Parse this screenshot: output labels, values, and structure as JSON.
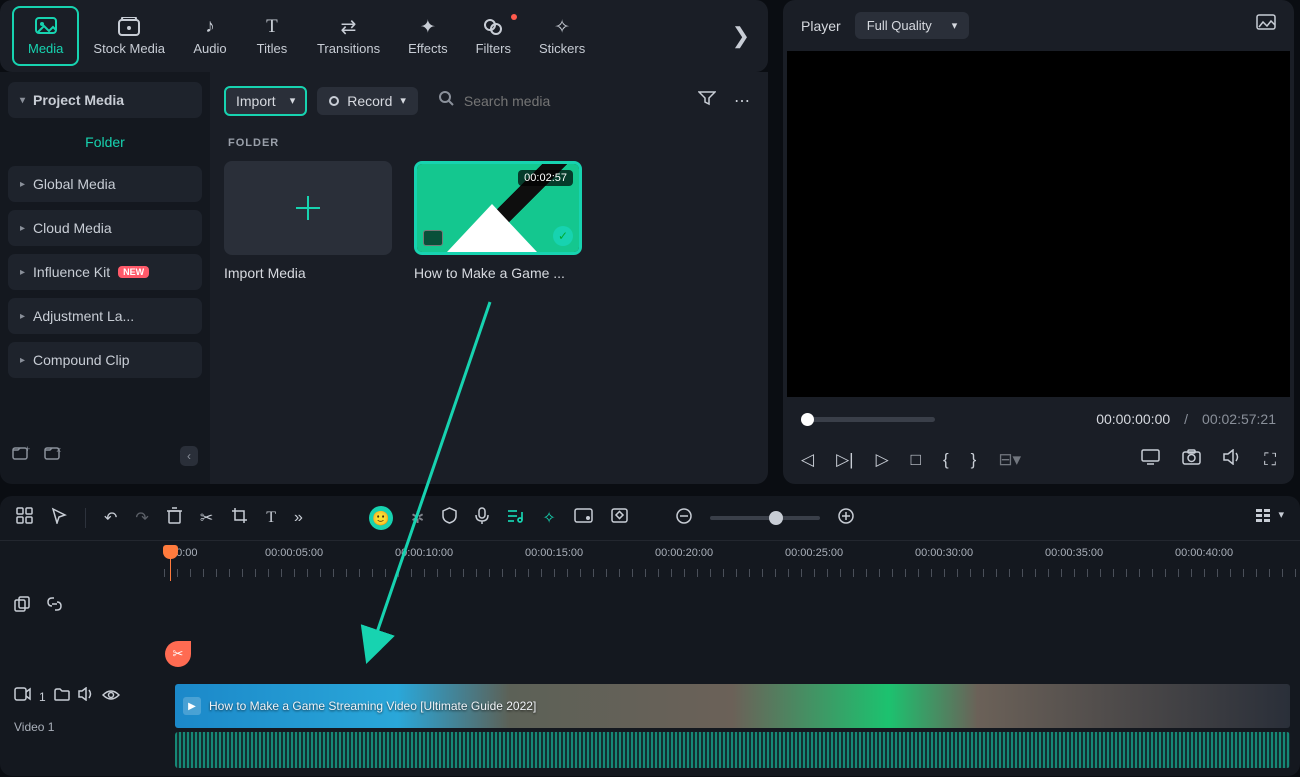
{
  "tabs": {
    "media": "Media",
    "stock_media": "Stock Media",
    "audio": "Audio",
    "titles": "Titles",
    "transitions": "Transitions",
    "effects": "Effects",
    "filters": "Filters",
    "stickers": "Stickers"
  },
  "player": {
    "label": "Player",
    "quality": "Full Quality",
    "current_time": "00:00:00:00",
    "separator": "/",
    "duration": "00:02:57:21"
  },
  "sidebar": {
    "project_media": "Project Media",
    "folder_label": "Folder",
    "global_media": "Global Media",
    "cloud_media": "Cloud Media",
    "influence_kit": "Influence Kit",
    "adjustment_layers": "Adjustment La...",
    "compound_clip": "Compound Clip",
    "new_badge": "NEW"
  },
  "media": {
    "import_btn": "Import",
    "record_btn": "Record",
    "search_placeholder": "Search media",
    "section_label": "FOLDER",
    "import_tile": "Import Media",
    "clip": {
      "duration": "00:02:57",
      "title": "How to Make a Game ..."
    }
  },
  "timeline": {
    "marks": [
      "00:00",
      "00:00:05:00",
      "00:00:10:00",
      "00:00:15:00",
      "00:00:20:00",
      "00:00:25:00",
      "00:00:30:00",
      "00:00:35:00",
      "00:00:40:00"
    ],
    "track_count": "1",
    "track_label": "Video 1",
    "clip_title": "How to Make a Game Streaming Video [Ultimate Guide 2022]"
  }
}
